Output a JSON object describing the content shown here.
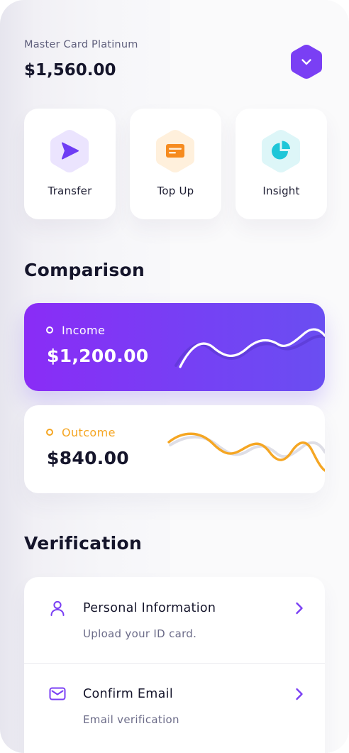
{
  "account": {
    "card_name": "Master Card Platinum",
    "balance": "$1,560.00",
    "dropdown_icon": "chevron-down-icon"
  },
  "actions": [
    {
      "label": "Transfer",
      "icon": "send-icon",
      "color": "#6e3df4",
      "bg": "#ebe4fe"
    },
    {
      "label": "Top Up",
      "icon": "card-icon",
      "color": "#f68b1f",
      "bg": "#fff0dc"
    },
    {
      "label": "Insight",
      "icon": "pie-chart-icon",
      "color": "#1fc6d8",
      "bg": "#ddf6f8"
    }
  ],
  "comparison": {
    "title": "Comparison",
    "income": {
      "label": "Income",
      "value": "$1,200.00"
    },
    "outcome": {
      "label": "Outcome",
      "value": "$840.00",
      "color": "#f5a623"
    }
  },
  "verification": {
    "title": "Verification",
    "items": [
      {
        "title": "Personal Information",
        "subtitle": "Upload your ID card.",
        "icon": "user-icon"
      },
      {
        "title": "Confirm Email",
        "subtitle": "Email verification",
        "icon": "mail-icon"
      }
    ]
  },
  "colors": {
    "accent": "#7a3ff4",
    "dark_text": "#15152b",
    "muted_text": "#6b6b88",
    "outcome": "#f5a623"
  }
}
